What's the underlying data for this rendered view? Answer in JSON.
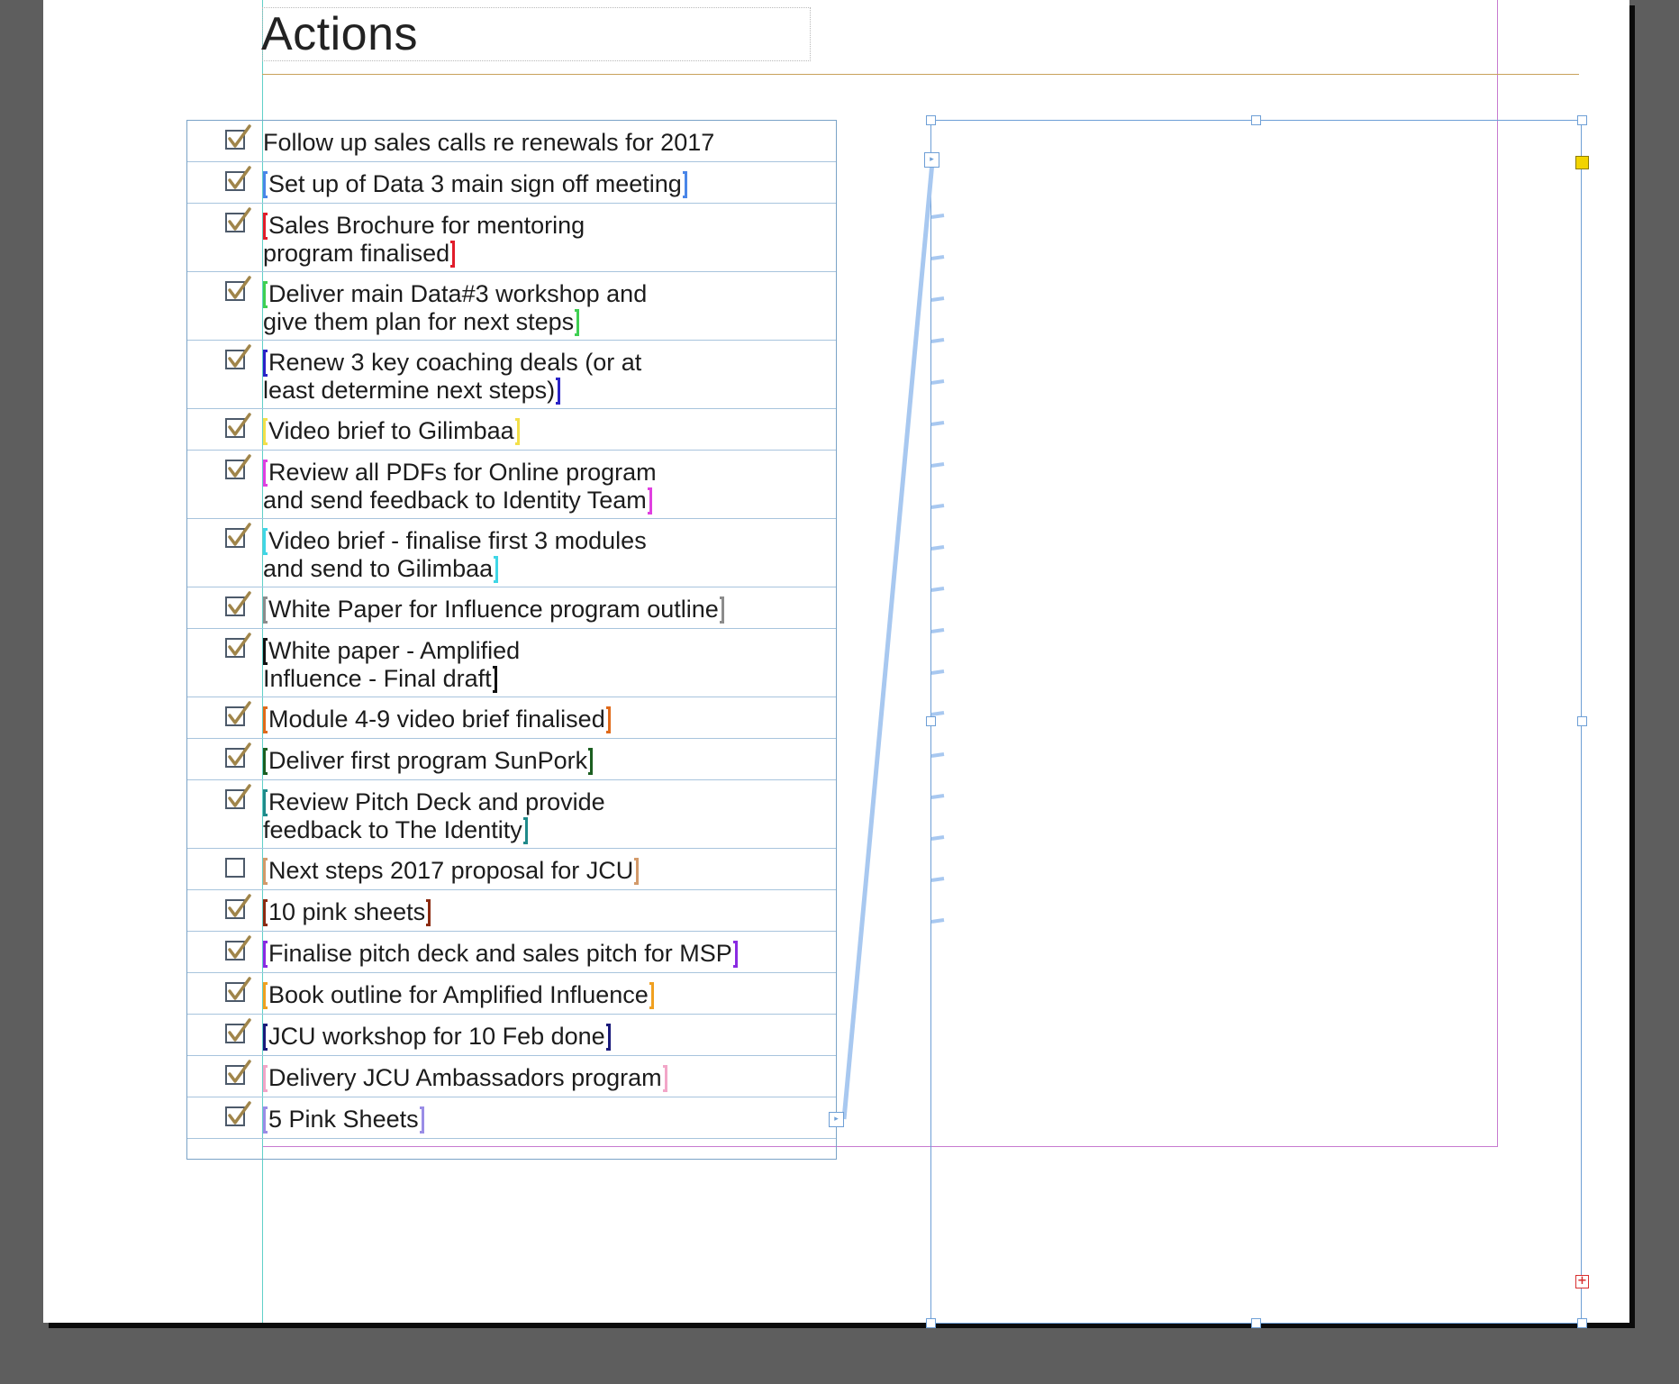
{
  "page": {
    "heading": "Actions"
  },
  "checklist": {
    "rows": [
      {
        "text": "Follow up sales calls re renewals for 2017",
        "checked": true,
        "bracket_color": ""
      },
      {
        "text": "Set up of Data 3 main sign off meeting",
        "checked": true,
        "bracket_color": "#4a86e8"
      },
      {
        "text": "Sales Brochure for mentoring\nprogram finalised",
        "checked": true,
        "bracket_color": "#e11d2a"
      },
      {
        "text": "Deliver main Data#3 workshop and\ngive them plan for next steps",
        "checked": true,
        "bracket_color": "#3fcf52"
      },
      {
        "text": "Renew 3 key coaching deals (or at\nleast determine next steps)",
        "checked": true,
        "bracket_color": "#2a23c7"
      },
      {
        "text": "Video brief to Gilimbaa",
        "checked": true,
        "bracket_color": "#f3e04a"
      },
      {
        "text": "Review all PDFs for Online program\nand send feedback to Identity Team",
        "checked": true,
        "bracket_color": "#e040e0"
      },
      {
        "text": "Video brief - finalise first 3 modules\nand send to Gilimbaa",
        "checked": true,
        "bracket_color": "#3fd6e6"
      },
      {
        "text": "White Paper for Influence program outline",
        "checked": true,
        "bracket_color": "#8c8c8c"
      },
      {
        "text": "White paper - Amplified\nInfluence - Final draft",
        "checked": true,
        "bracket_color": "#111111"
      },
      {
        "text": "Module 4-9 video brief finalised",
        "checked": true,
        "bracket_color": "#e06a1a"
      },
      {
        "text": "Deliver first program SunPork",
        "checked": true,
        "bracket_color": "#1b5e20"
      },
      {
        "text": "Review Pitch Deck and provide\nfeedback to The Identity",
        "checked": true,
        "bracket_color": "#1f8a8a"
      },
      {
        "text": "Next steps 2017 proposal for JCU",
        "checked": false,
        "bracket_color": "#d39a6a"
      },
      {
        "text": "10 pink sheets",
        "checked": true,
        "bracket_color": "#8b2a10"
      },
      {
        "text": "Finalise pitch deck and sales pitch for MSP",
        "checked": true,
        "bracket_color": "#8a2be2"
      },
      {
        "text": "Book outline for Amplified Influence",
        "checked": true,
        "bracket_color": "#f0a020"
      },
      {
        "text": "JCU workshop for 10 Feb done",
        "checked": true,
        "bracket_color": "#1a1a7a"
      },
      {
        "text": "Delivery JCU Ambassadors program",
        "checked": true,
        "bracket_color": "#f2a6c8"
      },
      {
        "text": "5 Pink Sheets",
        "checked": true,
        "bracket_color": "#9a8de6"
      }
    ]
  },
  "colors": {
    "frame_blue": "#6e9fd6",
    "thread_blue": "#a8c8f0",
    "margin_magenta": "#c77bd0",
    "check_gold": "#a0854a",
    "pasteboard": "#5e5e5e"
  },
  "icons": {
    "checkbox_checked": "checkbox-checked-icon",
    "checkbox_empty": "checkbox-empty-icon",
    "in_port": "in-port-icon",
    "out_port": "out-port-icon",
    "overset": "overset-icon"
  }
}
